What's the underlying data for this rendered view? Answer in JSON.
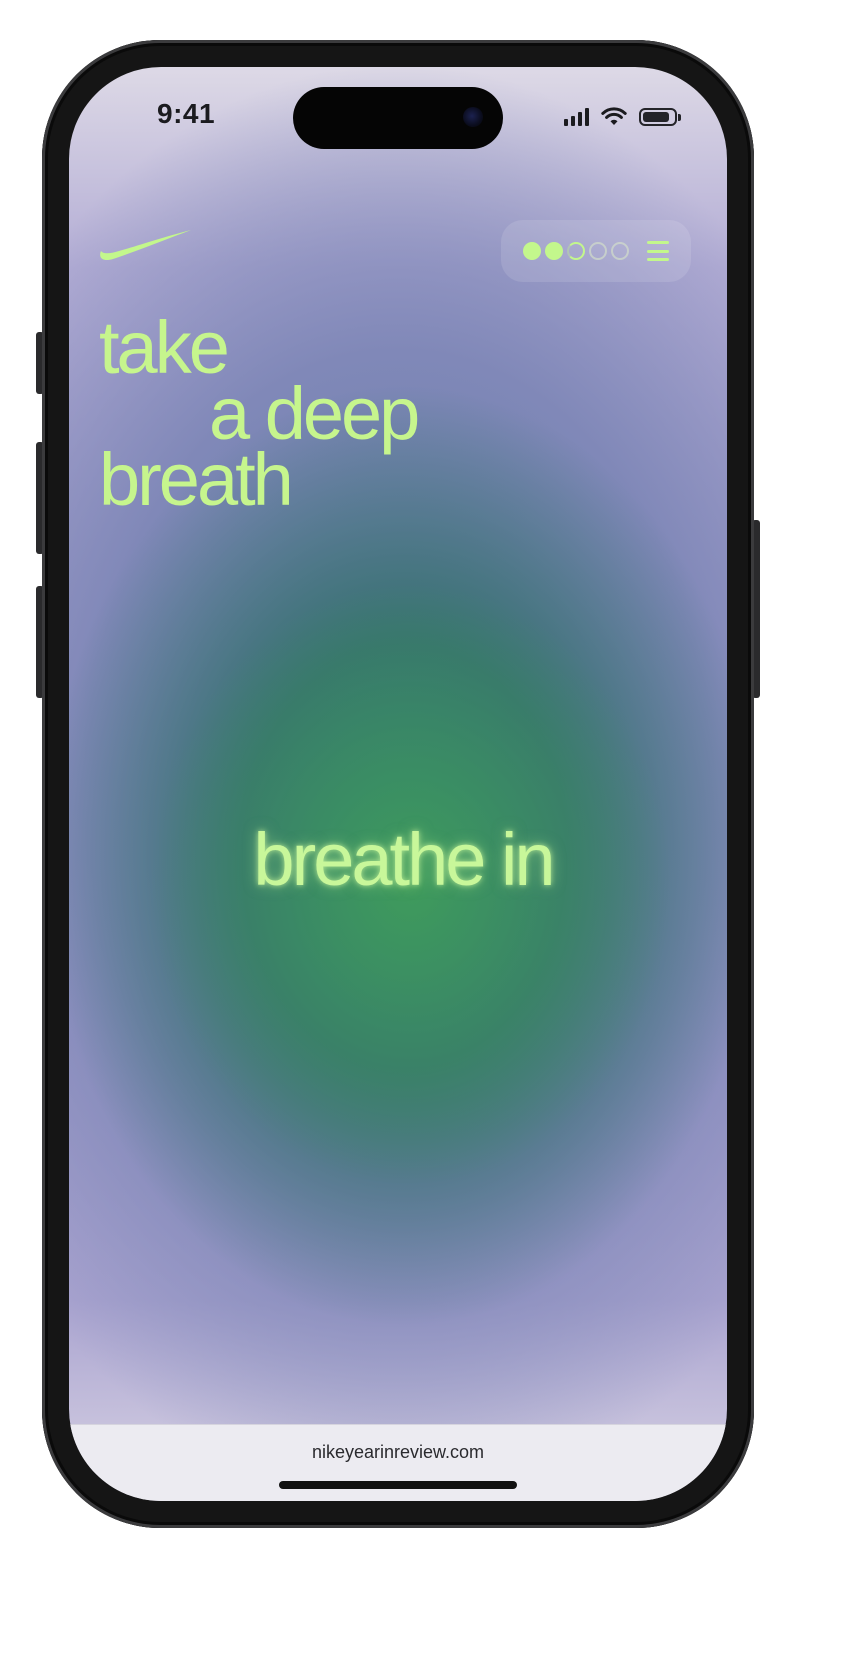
{
  "status_bar": {
    "time": "9:41",
    "battery_level": 0.85
  },
  "header": {
    "logo_icon": "nike-swoosh-icon",
    "progress": {
      "total_steps": 5,
      "completed_steps": 2,
      "current_step": 3
    },
    "menu_icon": "hamburger-menu-icon"
  },
  "headline": {
    "line1": "take",
    "line2": "a deep",
    "line3": "breath"
  },
  "prompt": "breathe in",
  "browser": {
    "url": "nikeyearinreview.com"
  },
  "colors": {
    "accent": "#c6f58d",
    "background_center": "#3f9b5c",
    "background_edge": "#b3add5"
  }
}
